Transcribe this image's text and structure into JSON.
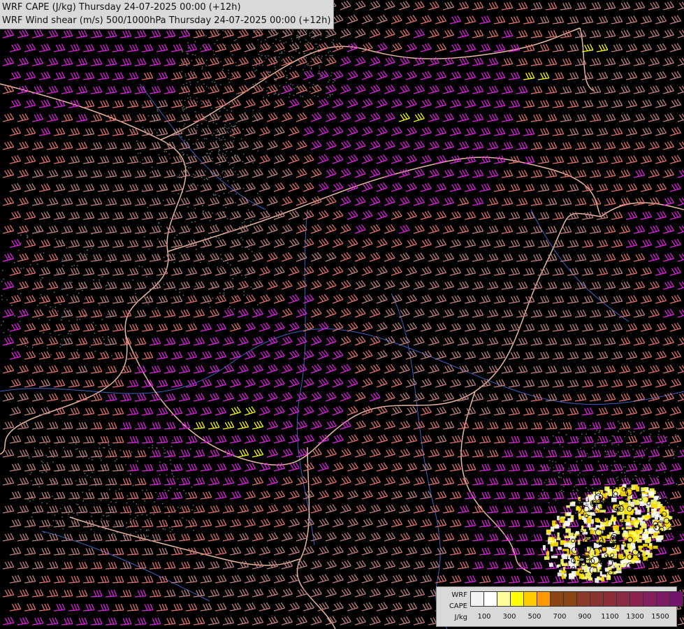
{
  "titles": {
    "line1": "WRF CAPE (J/kg) Thursday 24-07-2025 00:00 (+12h)",
    "line2": "WRF Wind shear (m/s) 500/1000hPa Thursday 24-07-2025 00:00 (+12h)"
  },
  "legend": {
    "label_top": "WRF",
    "label_mid": "CAPE",
    "label_bottom": "J/kg",
    "colors": [
      "#f2f2f2",
      "#ffffff",
      "#ffff99",
      "#ffff00",
      "#ffcc00",
      "#ff9900",
      "#8b4513",
      "#8b4513",
      "#8b3a2a",
      "#8b3333",
      "#8b2e3a",
      "#8b2a44",
      "#8b2250",
      "#86205c",
      "#7d1a66",
      "#74146d"
    ],
    "ticks": [
      "100",
      "300",
      "500",
      "700",
      "900",
      "1100",
      "1300",
      "1500"
    ]
  },
  "map": {
    "barb_colors": {
      "strong": "#e020e0",
      "medium": "#e07070",
      "light": "#c08080",
      "peak": "#ffff00"
    },
    "border_color": "#e8b8a0",
    "river_color": "#4060c0",
    "cape_colors": [
      "#ffffff",
      "#ffff66",
      "#ffe000"
    ]
  }
}
